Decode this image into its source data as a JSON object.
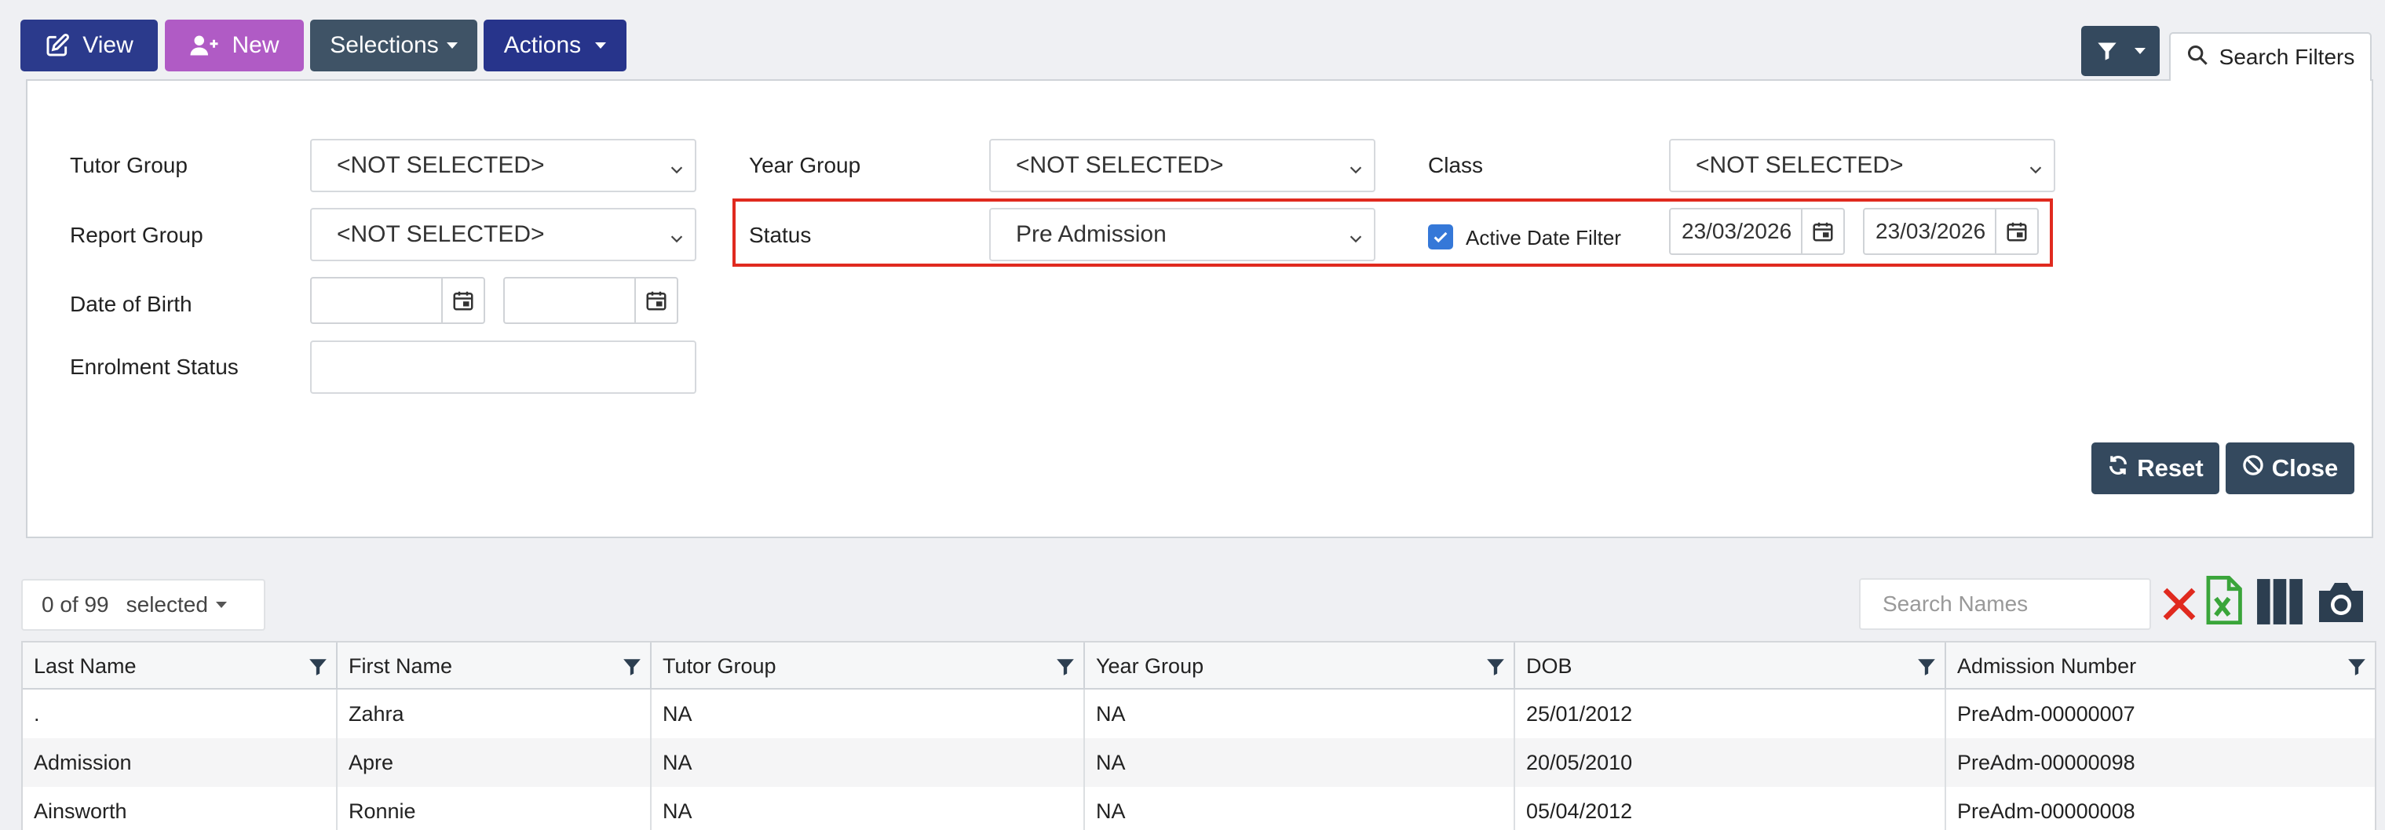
{
  "toolbar": {
    "view_label": "View",
    "new_label": "New",
    "selections_label": "Selections",
    "actions_label": "Actions",
    "search_filters_label": "Search Filters"
  },
  "filters": {
    "tutor_group": {
      "label": "Tutor Group",
      "value": "<NOT SELECTED>"
    },
    "year_group": {
      "label": "Year Group",
      "value": "<NOT SELECTED>"
    },
    "class": {
      "label": "Class",
      "value": "<NOT SELECTED>"
    },
    "report_group": {
      "label": "Report Group",
      "value": "<NOT SELECTED>"
    },
    "status": {
      "label": "Status",
      "value": "Pre Admission"
    },
    "active_date_filter": {
      "label": "Active Date Filter",
      "checked": true,
      "from": "23/03/2026",
      "to": "23/03/2026"
    },
    "date_of_birth": {
      "label": "Date of Birth",
      "from": "",
      "to": ""
    },
    "enrolment_status": {
      "label": "Enrolment Status",
      "value": ""
    },
    "reset_label": "Reset",
    "close_label": "Close"
  },
  "grid": {
    "selection_count": "0 of 99",
    "selection_label": "selected",
    "search_placeholder": "Search Names",
    "columns": [
      "Last Name",
      "First Name",
      "Tutor Group",
      "Year Group",
      "DOB",
      "Admission Number"
    ],
    "rows": [
      [
        ".",
        "Zahra",
        "NA",
        "NA",
        "25/01/2012",
        "PreAdm-00000007"
      ],
      [
        "Admission",
        "Apre",
        "NA",
        "NA",
        "20/05/2010",
        "PreAdm-00000098"
      ],
      [
        "Ainsworth",
        "Ronnie",
        "NA",
        "NA",
        "05/04/2012",
        "PreAdm-00000008"
      ]
    ]
  },
  "colors": {
    "view": "#2b3a8c",
    "new": "#b05bc5",
    "selections": "#3f5366",
    "actions": "#27348b",
    "filter_button": "#34495e",
    "highlight": "#e02a1f",
    "checkbox": "#3578d8"
  }
}
